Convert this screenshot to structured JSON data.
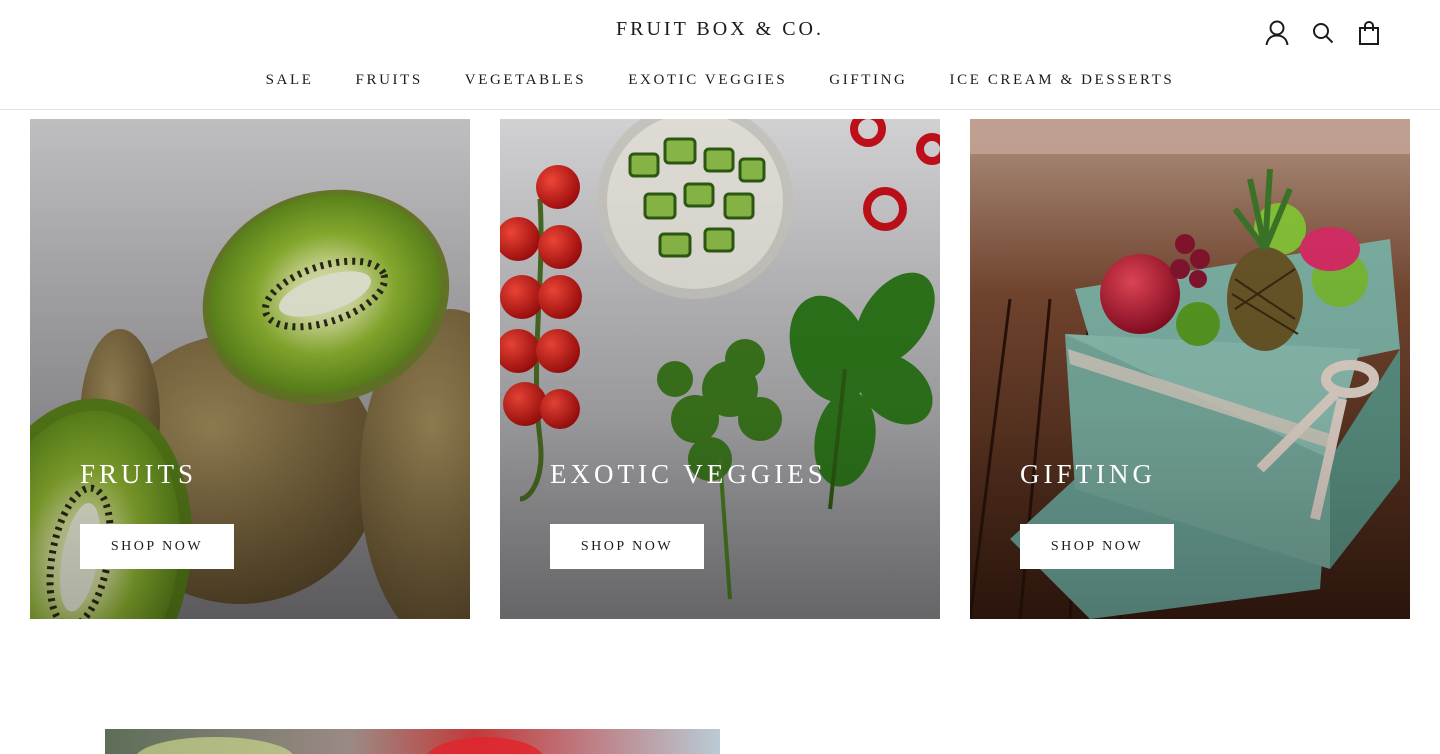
{
  "header": {
    "brand": "FRUIT BOX & CO.",
    "icons": [
      "account-icon",
      "search-icon",
      "cart-icon"
    ]
  },
  "nav": {
    "items": [
      "SALE",
      "FRUITS",
      "VEGETABLES",
      "EXOTIC VEGGIES",
      "GIFTING",
      "ICE CREAM & DESSERTS"
    ]
  },
  "collections": [
    {
      "title": "FRUITS",
      "button": "SHOP NOW",
      "image": "kiwi-photo"
    },
    {
      "title": "EXOTIC VEGGIES",
      "button": "SHOP NOW",
      "image": "vegetables-photo"
    },
    {
      "title": "GIFTING",
      "button": "SHOP NOW",
      "image": "gift-box-photo"
    }
  ],
  "colors": {
    "text": "#1c1b1b",
    "background": "#ffffff",
    "border": "#e3e3e3"
  }
}
